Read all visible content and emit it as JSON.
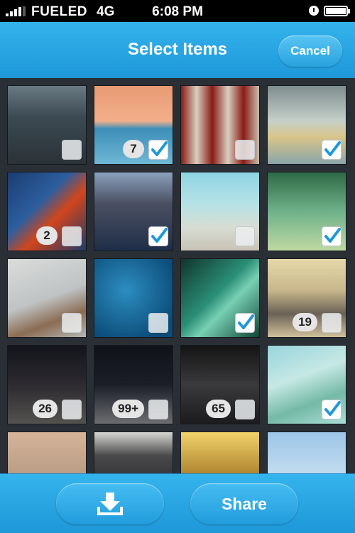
{
  "status_bar": {
    "carrier": "FUELED",
    "network": "4G",
    "time": "6:08 PM",
    "icons": [
      "signal-icon",
      "alarm-icon",
      "battery-icon"
    ]
  },
  "nav": {
    "title": "Select Items",
    "cancel_label": "Cancel"
  },
  "grid": {
    "items": [
      {
        "image": "city-street-buildings",
        "checked": false,
        "count": ""
      },
      {
        "image": "ocean-sunset",
        "checked": true,
        "count": "7"
      },
      {
        "image": "coca-cola-bottles",
        "checked": false,
        "count": ""
      },
      {
        "image": "winding-coastal-road",
        "checked": true,
        "count": ""
      },
      {
        "image": "golden-gate-bridge",
        "checked": false,
        "count": "2"
      },
      {
        "image": "city-lights-aerial",
        "checked": true,
        "count": ""
      },
      {
        "image": "beach-shoreline",
        "checked": false,
        "count": ""
      },
      {
        "image": "grass-plants",
        "checked": true,
        "count": ""
      },
      {
        "image": "coca-cola-can-laptop",
        "checked": false,
        "count": ""
      },
      {
        "image": "water-droplets-blue",
        "checked": false,
        "count": ""
      },
      {
        "image": "leaf-water-drops",
        "checked": true,
        "count": ""
      },
      {
        "image": "elephant",
        "checked": false,
        "count": "19"
      },
      {
        "image": "night-street-people",
        "checked": false,
        "count": "26"
      },
      {
        "image": "night-traffic-street",
        "checked": false,
        "count": "99+"
      },
      {
        "image": "engine-machine",
        "checked": false,
        "count": "65"
      },
      {
        "image": "lily-pads-pond",
        "checked": true,
        "count": ""
      },
      {
        "image": "misty-island",
        "checked": false,
        "count": ""
      },
      {
        "image": "marshall-amplifiers",
        "checked": false,
        "count": ""
      },
      {
        "image": "golden-leaves",
        "checked": false,
        "count": ""
      },
      {
        "image": "rooftop-sky",
        "checked": false,
        "count": ""
      }
    ]
  },
  "toolbar": {
    "download_icon": "download-icon",
    "share_label": "Share"
  },
  "colors": {
    "accent": "#1f98d9",
    "background": "#2a2f36"
  }
}
